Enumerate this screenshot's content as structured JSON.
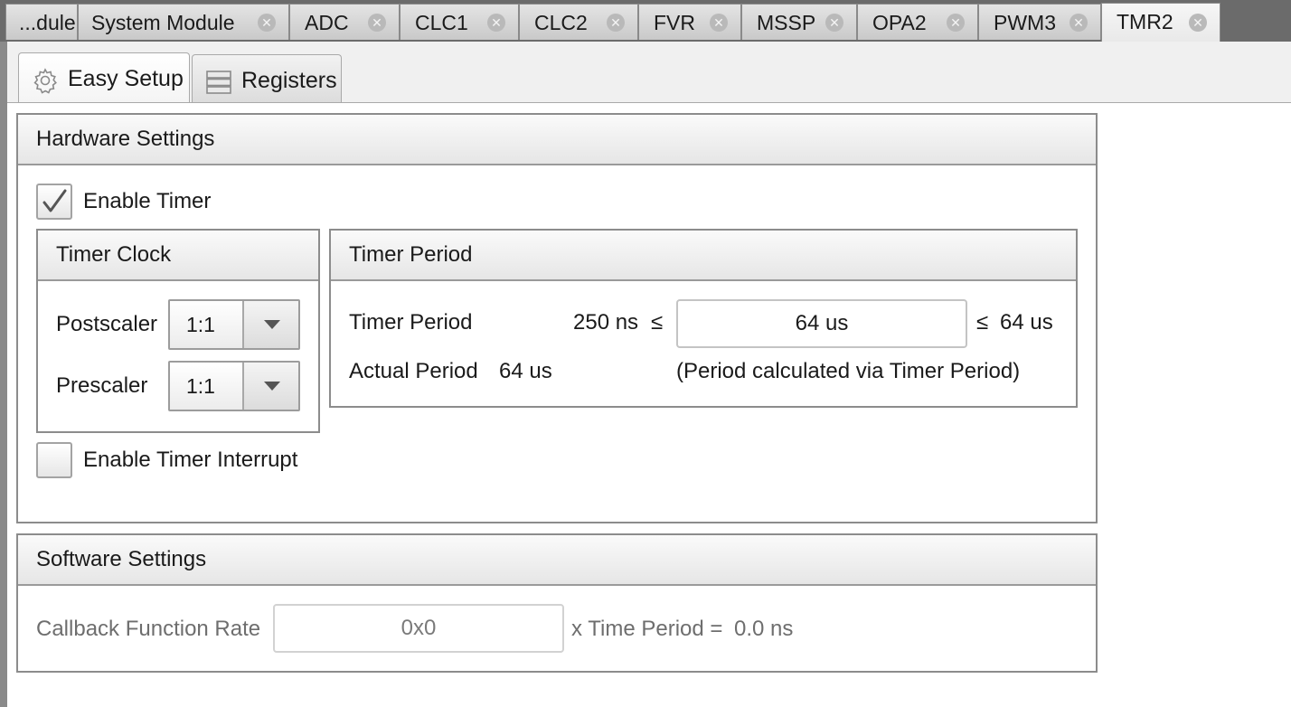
{
  "editor_tabs": [
    {
      "label": "...dule",
      "closable": false
    },
    {
      "label": "System Module",
      "closable": true
    },
    {
      "label": "ADC",
      "closable": true
    },
    {
      "label": "CLC1",
      "closable": true
    },
    {
      "label": "CLC2",
      "closable": true
    },
    {
      "label": "FVR",
      "closable": true
    },
    {
      "label": "MSSP",
      "closable": true
    },
    {
      "label": "OPA2",
      "closable": true
    },
    {
      "label": "PWM3",
      "closable": true
    },
    {
      "label": "TMR2",
      "closable": true,
      "active": true
    }
  ],
  "close_glyph": "✕",
  "sub_tabs": {
    "easy_setup": {
      "label": "Easy Setup",
      "icon": "gear-icon",
      "active": true
    },
    "registers": {
      "label": "Registers",
      "icon": "registers-icon",
      "active": false
    }
  },
  "hardware": {
    "title": "Hardware Settings",
    "enable_timer": {
      "label": "Enable Timer",
      "checked": true
    },
    "timer_clock": {
      "title": "Timer Clock",
      "postscaler": {
        "label": "Postscaler",
        "value": "1:1"
      },
      "prescaler": {
        "label": "Prescaler",
        "value": "1:1"
      }
    },
    "timer_period": {
      "title": "Timer Period",
      "period_label": "Timer Period",
      "min_text": "250 ns",
      "le_symbol": "≤",
      "value": "64 us",
      "max_text": "64 us",
      "actual_label": "Actual Period",
      "actual_value": "64 us",
      "note": "(Period calculated via Timer Period)"
    },
    "enable_interrupt": {
      "label": "Enable Timer Interrupt",
      "checked": false
    }
  },
  "software": {
    "title": "Software Settings",
    "callback_label": "Callback Function Rate",
    "callback_value": "0x0",
    "suffix_label": "x Time Period =",
    "result": "0.0 ns"
  },
  "colors": {
    "tab_strip": "#6b6b6b",
    "panel_border": "#8c8c8c",
    "disabled_text": "#6e6e6e"
  }
}
